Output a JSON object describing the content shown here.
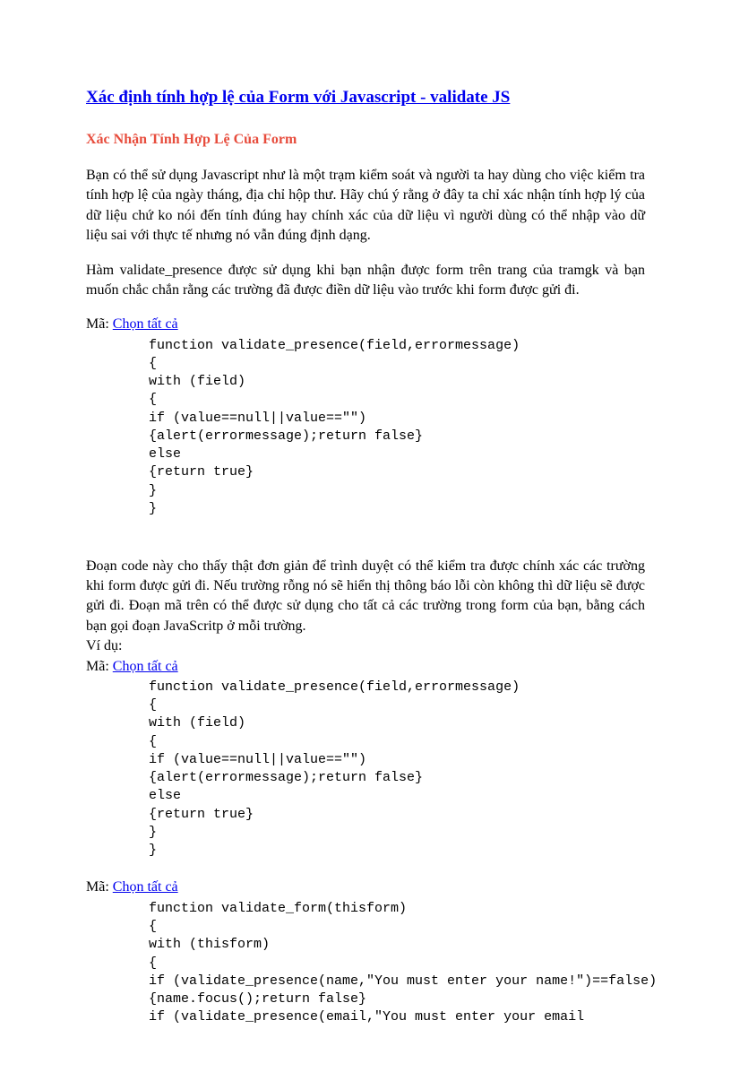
{
  "title": "Xác định tính hợp lệ của Form với Javascript - validate JS",
  "subtitle": "Xác Nhận Tính Hợp Lệ Của Form",
  "para1": "Bạn có thể sử dụng Javascript như là một trạm kiểm soát và người ta hay dùng cho việc kiểm tra tính hợp lệ của ngày tháng, địa chỉ hộp thư. Hãy chú ý rằng ở đây ta chỉ xác nhận tính hợp lý của dữ liệu chứ ko nói đến tính đúng hay chính xác của dữ liệu vì người dùng có thể nhập vào dữ liệu sai với thực tế nhưng nó vẫn đúng định dạng.",
  "para2": "Hàm validate_presence  được sử dụng khi bạn nhận được form trên trang của tramgk và bạn muốn chắc chắn rằng các trường đã được điền dữ liệu vào trước khi form được gửi đi.",
  "codeLabel": "Mã: ",
  "selectAll": "Chọn tất cả",
  "code1": "function validate_presence(field,errormessage)\n{\nwith (field)\n{\nif (value==null||value==\"\")\n{alert(errormessage);return false}\nelse\n{return true}\n}\n}",
  "para3": "Đoạn code này cho thấy thật đơn giản để trình duyệt có thể kiểm tra được chính xác các trường khi form được gửi đi. Nếu trường rỗng nó sẽ hiển thị thông báo lỗi còn không thì dữ liệu sẽ được gửi đi. Đoạn mã trên có thể được sử dụng cho tất cả các trường trong form của bạn, bằng cách bạn gọi đoạn JavaScritp ở mỗi trường.",
  "vidu": "Ví dụ:",
  "code2": "function validate_presence(field,errormessage)\n{\nwith (field)\n{\nif (value==null||value==\"\")\n{alert(errormessage);return false}\nelse\n{return true}\n}\n}",
  "code3": "function validate_form(thisform)\n{\nwith (thisform)\n{\nif (validate_presence(name,\"You must enter your name!\")==false)\n{name.focus();return false}\nif (validate_presence(email,\"You must enter your email"
}
